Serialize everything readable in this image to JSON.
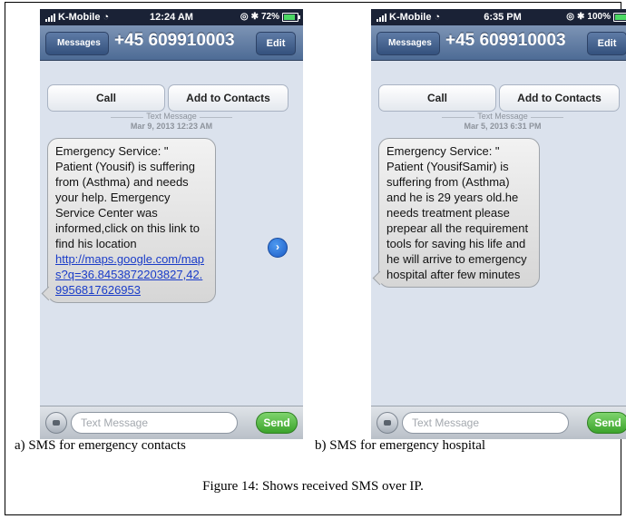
{
  "phones": [
    {
      "status": {
        "carrier": "K-Mobile",
        "time": "12:24 AM",
        "battery": "72%",
        "battery_level": 0.72
      },
      "nav": {
        "back": "Messages",
        "title": "+45 609910003",
        "edit": "Edit"
      },
      "actions": {
        "call": "Call",
        "add": "Add to Contacts"
      },
      "meta": {
        "label": "Text Message",
        "date": "Mar 9, 2013 12:23 AM"
      },
      "message": {
        "text": "Emergency Service: \" Patient (Yousif) is suffering from (Asthma) and needs your help. Emergency Service Center was informed,click on this link to find his location",
        "link": "http://maps.google.com/maps?q=36.8453872203827,42.9956817626953"
      },
      "input": {
        "placeholder": "Text Message",
        "send": "Send"
      },
      "caption": "a) SMS for emergency contacts"
    },
    {
      "status": {
        "carrier": "K-Mobile",
        "time": "6:35 PM",
        "battery": "100%",
        "battery_level": 1.0
      },
      "nav": {
        "back": "Messages",
        "title": "+45 609910003",
        "edit": "Edit"
      },
      "actions": {
        "call": "Call",
        "add": "Add to Contacts"
      },
      "meta": {
        "label": "Text Message",
        "date": "Mar 5, 2013 6:31 PM"
      },
      "message": {
        "text": "Emergency Service: \" Patient (YousifSamir) is suffering from (Asthma) and he is 29 years old.he needs treatment please prepear all the requirement tools for saving his life and he will arrive to emergency hospital after few minutes"
      },
      "input": {
        "placeholder": "Text Message",
        "send": "Send"
      },
      "caption": "b) SMS for emergency hospital"
    }
  ],
  "figure_caption": "Figure 14: Shows received SMS over IP.",
  "colors": {
    "nav": "#5a7aa3",
    "link": "#1a3cc8",
    "send": "#3ba32b",
    "background": "#dbe2ed"
  }
}
